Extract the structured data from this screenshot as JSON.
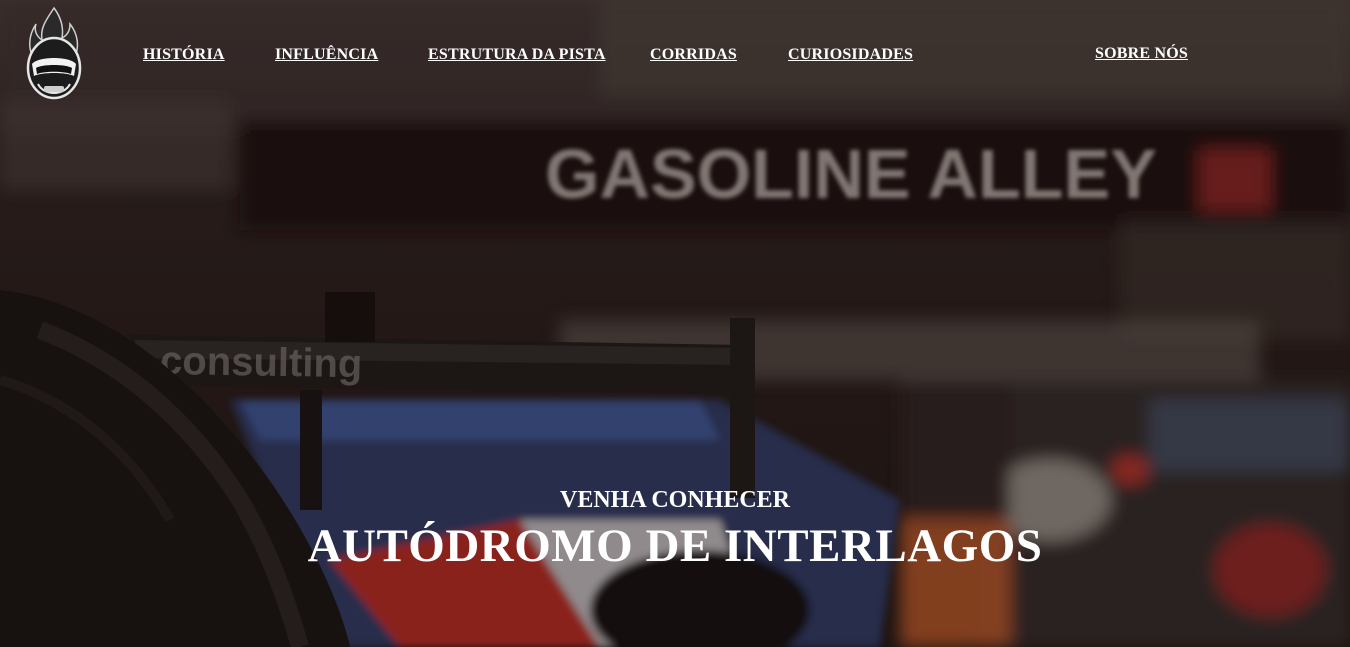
{
  "nav": {
    "items": [
      {
        "label": "HISTÓRIA"
      },
      {
        "label": "INFLUÊNCIA"
      },
      {
        "label": "ESTRUTURA DA PISTA"
      },
      {
        "label": "CORRIDAS"
      },
      {
        "label": "CURIOSIDADES"
      },
      {
        "label": "SOBRE NÓS"
      }
    ]
  },
  "hero": {
    "background_sign": "GASOLINE ALLEY",
    "wing_text": "consulting",
    "subtitle": "VENHA CONHECER",
    "title": "AUTÓDROMO DE INTERLAGOS"
  },
  "colors": {
    "text": "#ffffff",
    "overlay": "#231412",
    "accent_red": "#b22a22"
  },
  "icons": {
    "logo": "helmet-flame-icon"
  }
}
